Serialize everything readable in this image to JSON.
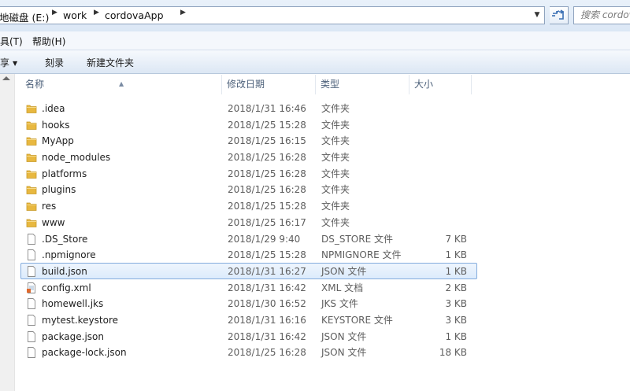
{
  "address": {
    "breadcrumbs": [
      "地磁盘 (E:)",
      "work",
      "cordovaApp"
    ],
    "search_placeholder": "搜索 cordovaApp"
  },
  "menu": {
    "items": [
      "具(T)",
      "帮助(H)"
    ]
  },
  "commands": {
    "share_label": "享",
    "burn_label": "刻录",
    "new_folder_label": "新建文件夹"
  },
  "columns": {
    "name": "名称",
    "modified": "修改日期",
    "type": "类型",
    "size": "大小"
  },
  "files": [
    {
      "name": ".idea",
      "modified": "2018/1/31 16:46",
      "type": "文件夹",
      "size": "",
      "icon": "folder-icon"
    },
    {
      "name": "hooks",
      "modified": "2018/1/25 15:28",
      "type": "文件夹",
      "size": "",
      "icon": "folder-icon"
    },
    {
      "name": "MyApp",
      "modified": "2018/1/25 16:15",
      "type": "文件夹",
      "size": "",
      "icon": "folder-icon"
    },
    {
      "name": "node_modules",
      "modified": "2018/1/25 16:28",
      "type": "文件夹",
      "size": "",
      "icon": "folder-icon"
    },
    {
      "name": "platforms",
      "modified": "2018/1/25 16:28",
      "type": "文件夹",
      "size": "",
      "icon": "folder-icon"
    },
    {
      "name": "plugins",
      "modified": "2018/1/25 16:28",
      "type": "文件夹",
      "size": "",
      "icon": "folder-icon"
    },
    {
      "name": "res",
      "modified": "2018/1/25 15:28",
      "type": "文件夹",
      "size": "",
      "icon": "folder-icon"
    },
    {
      "name": "www",
      "modified": "2018/1/25 16:17",
      "type": "文件夹",
      "size": "",
      "icon": "folder-icon"
    },
    {
      "name": ".DS_Store",
      "modified": "2018/1/29 9:40",
      "type": "DS_STORE 文件",
      "size": "7 KB",
      "icon": "file-icon"
    },
    {
      "name": ".npmignore",
      "modified": "2018/1/25 15:28",
      "type": "NPMIGNORE 文件",
      "size": "1 KB",
      "icon": "file-icon"
    },
    {
      "name": "build.json",
      "modified": "2018/1/31 16:27",
      "type": "JSON 文件",
      "size": "1 KB",
      "icon": "file-icon",
      "selected": true
    },
    {
      "name": "config.xml",
      "modified": "2018/1/31 16:42",
      "type": "XML 文档",
      "size": "2 KB",
      "icon": "xml-file-icon"
    },
    {
      "name": "homewell.jks",
      "modified": "2018/1/30 16:52",
      "type": "JKS 文件",
      "size": "3 KB",
      "icon": "file-icon"
    },
    {
      "name": "mytest.keystore",
      "modified": "2018/1/31 16:16",
      "type": "KEYSTORE 文件",
      "size": "3 KB",
      "icon": "file-icon"
    },
    {
      "name": "package.json",
      "modified": "2018/1/31 16:42",
      "type": "JSON 文件",
      "size": "1 KB",
      "icon": "file-icon"
    },
    {
      "name": "package-lock.json",
      "modified": "2018/1/25 16:28",
      "type": "JSON 文件",
      "size": "18 KB",
      "icon": "file-icon"
    }
  ],
  "colors": {
    "folder": "#e8b840",
    "selection_border": "#84acdd",
    "header_text": "#4c607a"
  }
}
